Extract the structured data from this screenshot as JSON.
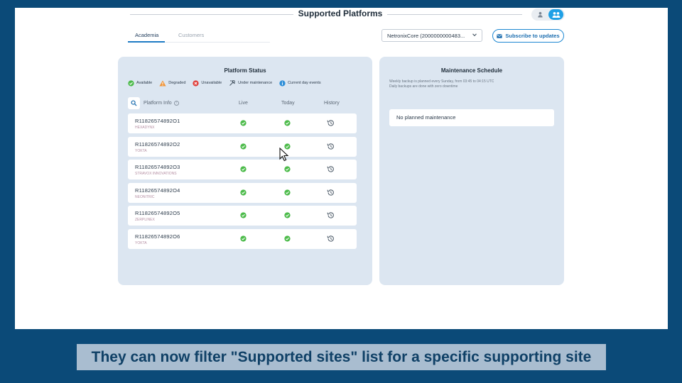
{
  "header": {
    "title": "Supported Platforms"
  },
  "tabs": [
    {
      "label": "Academia"
    },
    {
      "label": "Customers"
    }
  ],
  "platform_select": {
    "value": "NetronixCore (2000000000483..."
  },
  "subscribe": {
    "label": "Subscribe to updates"
  },
  "status_panel": {
    "title": "Platform Status",
    "legend": {
      "available": "Available",
      "degraded": "Degraded",
      "unavailable": "Unavailable",
      "maintenance": "Under maintenance",
      "events": "Current day events"
    },
    "columns": {
      "info": "Platform Info",
      "live": "Live",
      "today": "Today",
      "history": "History"
    },
    "rows": [
      {
        "id": "R11826574892O1",
        "name": "HEXADYNX"
      },
      {
        "id": "R11826574892O2",
        "name": "YOKTA"
      },
      {
        "id": "R11826574892O3",
        "name": "STRAVOX INNOVATIONS"
      },
      {
        "id": "R11826574892O4",
        "name": "NEONITRIC"
      },
      {
        "id": "R11826574892O5",
        "name": "ZERPLINEX"
      },
      {
        "id": "R11826574892O6",
        "name": "YOKTA"
      }
    ]
  },
  "maintenance_panel": {
    "title": "Maintenance Schedule",
    "note_line1": "Weekly backup is planned every Sunday, from 03:45 to 04:15 UTC",
    "note_line2": "Daily backups are done with zero downtime",
    "empty": "No planned maintenance"
  },
  "caption": "They can now filter \"Supported sites\" list for a specific supporting site",
  "colors": {
    "accent": "#1e7bc4",
    "ok": "#4cbb4a",
    "panel": "#dce6f1",
    "frame": "#0b4a78"
  }
}
